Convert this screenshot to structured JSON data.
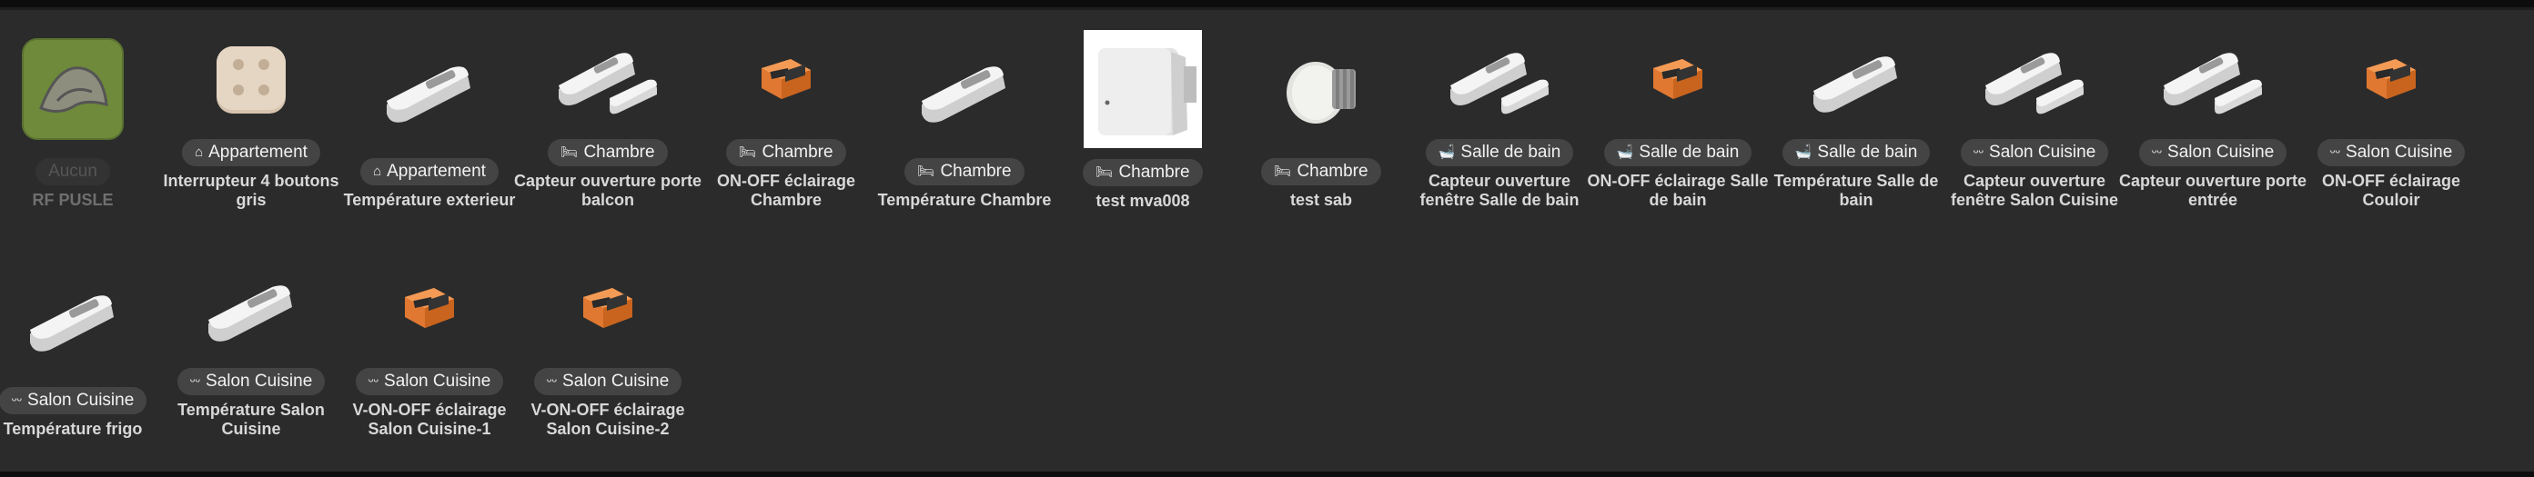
{
  "devices": [
    {
      "room": "Aucun",
      "room_icon": "",
      "name": "RF PUSLE",
      "icon": "jeedom-plugin-icon",
      "dim": true
    },
    {
      "room": "Appartement",
      "room_icon": "house-icon",
      "name": "Interrupteur 4 boutons gris",
      "icon": "wall-switch-icon"
    },
    {
      "room": "Appartement",
      "room_icon": "house-icon",
      "name": "Température exterieur",
      "icon": "temperature-sensor-icon"
    },
    {
      "room": "Chambre",
      "room_icon": "bed-icon",
      "name": "Capteur ouverture porte balcon",
      "icon": "door-window-sensor-icon"
    },
    {
      "room": "Chambre",
      "room_icon": "bed-icon",
      "name": "ON-OFF éclairage Chambre",
      "icon": "relay-module-icon"
    },
    {
      "room": "Chambre",
      "room_icon": "bed-icon",
      "name": "Température Chambre",
      "icon": "temperature-sensor-icon"
    },
    {
      "room": "Chambre",
      "room_icon": "bed-icon",
      "name": "test mva008",
      "icon": "thermostat-head-box-icon"
    },
    {
      "room": "Chambre",
      "room_icon": "bed-icon",
      "name": "test sab",
      "icon": "radiator-valve-icon"
    },
    {
      "room": "Salle de bain",
      "room_icon": "bathtub-icon",
      "name": "Capteur ouverture fenêtre Salle de bain",
      "icon": "door-window-sensor-icon"
    },
    {
      "room": "Salle de bain",
      "room_icon": "bathtub-icon",
      "name": "ON-OFF éclairage Salle de bain",
      "icon": "relay-module-icon"
    },
    {
      "room": "Salle de bain",
      "room_icon": "bathtub-icon",
      "name": "Température Salle de bain",
      "icon": "temperature-sensor-icon"
    },
    {
      "room": "Salon Cuisine",
      "room_icon": "sofa-icon",
      "name": "Capteur ouverture fenêtre Salon Cuisine",
      "icon": "door-window-sensor-icon"
    },
    {
      "room": "Salon Cuisine",
      "room_icon": "sofa-icon",
      "name": "Capteur ouverture porte entrée",
      "icon": "door-window-sensor-icon"
    },
    {
      "room": "Salon Cuisine",
      "room_icon": "sofa-icon",
      "name": "ON-OFF éclairage Couloir",
      "icon": "relay-module-icon"
    },
    {
      "room": "Salon Cuisine",
      "room_icon": "sofa-icon",
      "name": "Température frigo",
      "icon": "temperature-sensor-icon"
    },
    {
      "room": "Salon Cuisine",
      "room_icon": "sofa-icon",
      "name": "Température Salon Cuisine",
      "icon": "temperature-sensor-icon"
    },
    {
      "room": "Salon Cuisine",
      "room_icon": "sofa-icon",
      "name": "V-ON-OFF éclairage Salon Cuisine-1",
      "icon": "relay-module-icon"
    },
    {
      "room": "Salon Cuisine",
      "room_icon": "sofa-icon",
      "name": "V-ON-OFF éclairage Salon Cuisine-2",
      "icon": "relay-module-icon"
    }
  ]
}
